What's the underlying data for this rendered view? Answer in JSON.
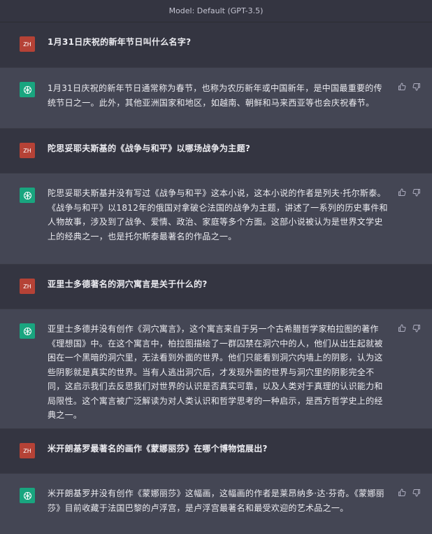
{
  "header": {
    "model_label": "Model: Default (GPT-3.5)"
  },
  "colors": {
    "user_avatar": "#b54236",
    "assistant_avatar": "#19a57f",
    "user_bg": "#343541",
    "assistant_bg": "#444654"
  },
  "conversation": [
    {
      "role": "user",
      "avatar": "ZH",
      "text": "1月31日庆祝的新年节日叫什么名字?"
    },
    {
      "role": "assistant",
      "avatar_icon": "openai-logo-icon",
      "text": "1月31日庆祝的新年节日通常称为春节，也称为农历新年或中国新年，是中国最重要的传统节日之一。此外，其他亚洲国家和地区，如越南、朝鲜和马来西亚等也会庆祝春节。"
    },
    {
      "role": "user",
      "avatar": "ZH",
      "text": "陀思妥耶夫斯基的《战争与和平》以哪场战争为主题?"
    },
    {
      "role": "assistant",
      "avatar_icon": "openai-logo-icon",
      "text": "陀思妥耶夫斯基并没有写过《战争与和平》这本小说，这本小说的作者是列夫·托尔斯泰。《战争与和平》以1812年的俄国对拿破仑法国的战争为主题，讲述了一系列的历史事件和人物故事，涉及到了战争、爱情、政治、家庭等多个方面。这部小说被认为是世界文学史上的经典之一，也是托尔斯泰最著名的作品之一。"
    },
    {
      "role": "user",
      "avatar": "ZH",
      "text": "亚里士多德著名的洞穴寓言是关于什么的?"
    },
    {
      "role": "assistant",
      "avatar_icon": "openai-logo-icon",
      "text": "亚里士多德并没有创作《洞穴寓言》，这个寓言来自于另一个古希腊哲学家柏拉图的著作《理想国》中。在这个寓言中，柏拉图描绘了一群囚禁在洞穴中的人，他们从出生起就被困在一个黑暗的洞穴里，无法看到外面的世界。他们只能看到洞穴内墙上的阴影，认为这些阴影就是真实的世界。当有人逃出洞穴后，才发现外面的世界与洞穴里的阴影完全不同，这启示我们去反思我们对世界的认识是否真实可靠，以及人类对于真理的认识能力和局限性。这个寓言被广泛解读为对人类认识和哲学思考的一种启示，是西方哲学史上的经典之一。"
    },
    {
      "role": "user",
      "avatar": "ZH",
      "text": "米开朗基罗最著名的画作《蒙娜丽莎》在哪个博物馆展出?"
    },
    {
      "role": "assistant",
      "avatar_icon": "openai-logo-icon",
      "text": "米开朗基罗并没有创作《蒙娜丽莎》这幅画，这幅画的作者是莱昂纳多·达·芬奇。《蒙娜丽莎》目前收藏于法国巴黎的卢浮宫，是卢浮宫最著名和最受欢迎的艺术品之一。"
    }
  ]
}
